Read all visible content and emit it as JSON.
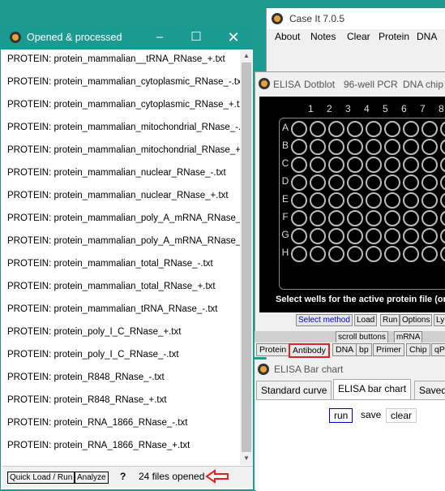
{
  "case_it": {
    "title": "Case It 7.0.5",
    "menu": [
      "About",
      "Notes",
      "Clear",
      "Protein",
      "DNA"
    ]
  },
  "elisa": {
    "tabs": [
      "ELISA",
      "Dotblot",
      "96-well PCR",
      "DNA chip"
    ],
    "rows": [
      "A",
      "B",
      "C",
      "D",
      "E",
      "F",
      "G",
      "H"
    ],
    "cols": [
      "1",
      "2",
      "3",
      "4",
      "5",
      "6",
      "7",
      "8"
    ],
    "status": "Select wells for the active protein file (or ope",
    "buttons": [
      "Select method",
      "Load",
      "Run",
      "Options",
      "Ly"
    ],
    "scroll_buttons_label": "scroll buttons",
    "mrna_label": "mRNA",
    "tool_tabs": [
      "Protein",
      "Antibody",
      "DNA",
      "bp",
      "Primer",
      "Chip",
      "qP"
    ]
  },
  "bar_chart": {
    "title": "ELISA Bar chart",
    "tabs": [
      "Standard curve",
      "ELISA bar chart",
      "Saved"
    ],
    "actions": [
      "run",
      "save",
      "clear"
    ]
  },
  "window": {
    "title": "Opened & processed",
    "items": [
      "PROTEIN: protein_mammalian__tRNA_RNase_+.txt",
      "PROTEIN: protein_mammalian_cytoplasmic_RNase_-.txt",
      "PROTEIN: protein_mammalian_cytoplasmic_RNase_+.txt",
      "PROTEIN: protein_mammalian_mitochondrial_RNase_-.txt",
      "PROTEIN: protein_mammalian_mitochondrial_RNase_+.txt",
      "PROTEIN: protein_mammalian_nuclear_RNase_-.txt",
      "PROTEIN: protein_mammalian_nuclear_RNase_+.txt",
      "PROTEIN: protein_mammalian_poly_A_mRNA_RNase_-.txt",
      "PROTEIN: protein_mammalian_poly_A_mRNA_RNase_+.txt",
      "PROTEIN: protein_mammalian_total_RNase_-.txt",
      "PROTEIN: protein_mammalian_total_RNase_+.txt",
      "PROTEIN: protein_mammalian_tRNA_RNase_-.txt",
      "PROTEIN: protein_poly_I_C_RNase_+.txt",
      "PROTEIN: protein_poly_I_C_RNase_-.txt",
      "PROTEIN: protein_R848_RNase_-.txt",
      "PROTEIN: protein_R848_RNase_+.txt",
      "PROTEIN: protein_RNA_1866_RNase_-.txt",
      "PROTEIN: protein_RNA_1866_RNase_+.txt"
    ],
    "footer": {
      "quick_load_label": "Quick Load / Run",
      "analyze_label": "Analyze",
      "help_label": "?",
      "status": "24  files opened"
    }
  },
  "icons": {
    "app": "case-it-icon",
    "minimize": "minimize-icon",
    "maximize": "maximize-icon",
    "close": "close-icon",
    "arrow": "red-arrow-icon"
  },
  "colors": {
    "titlebar": "#1a9a90",
    "highlight": "#d22222",
    "link_blue": "#0000cc"
  }
}
